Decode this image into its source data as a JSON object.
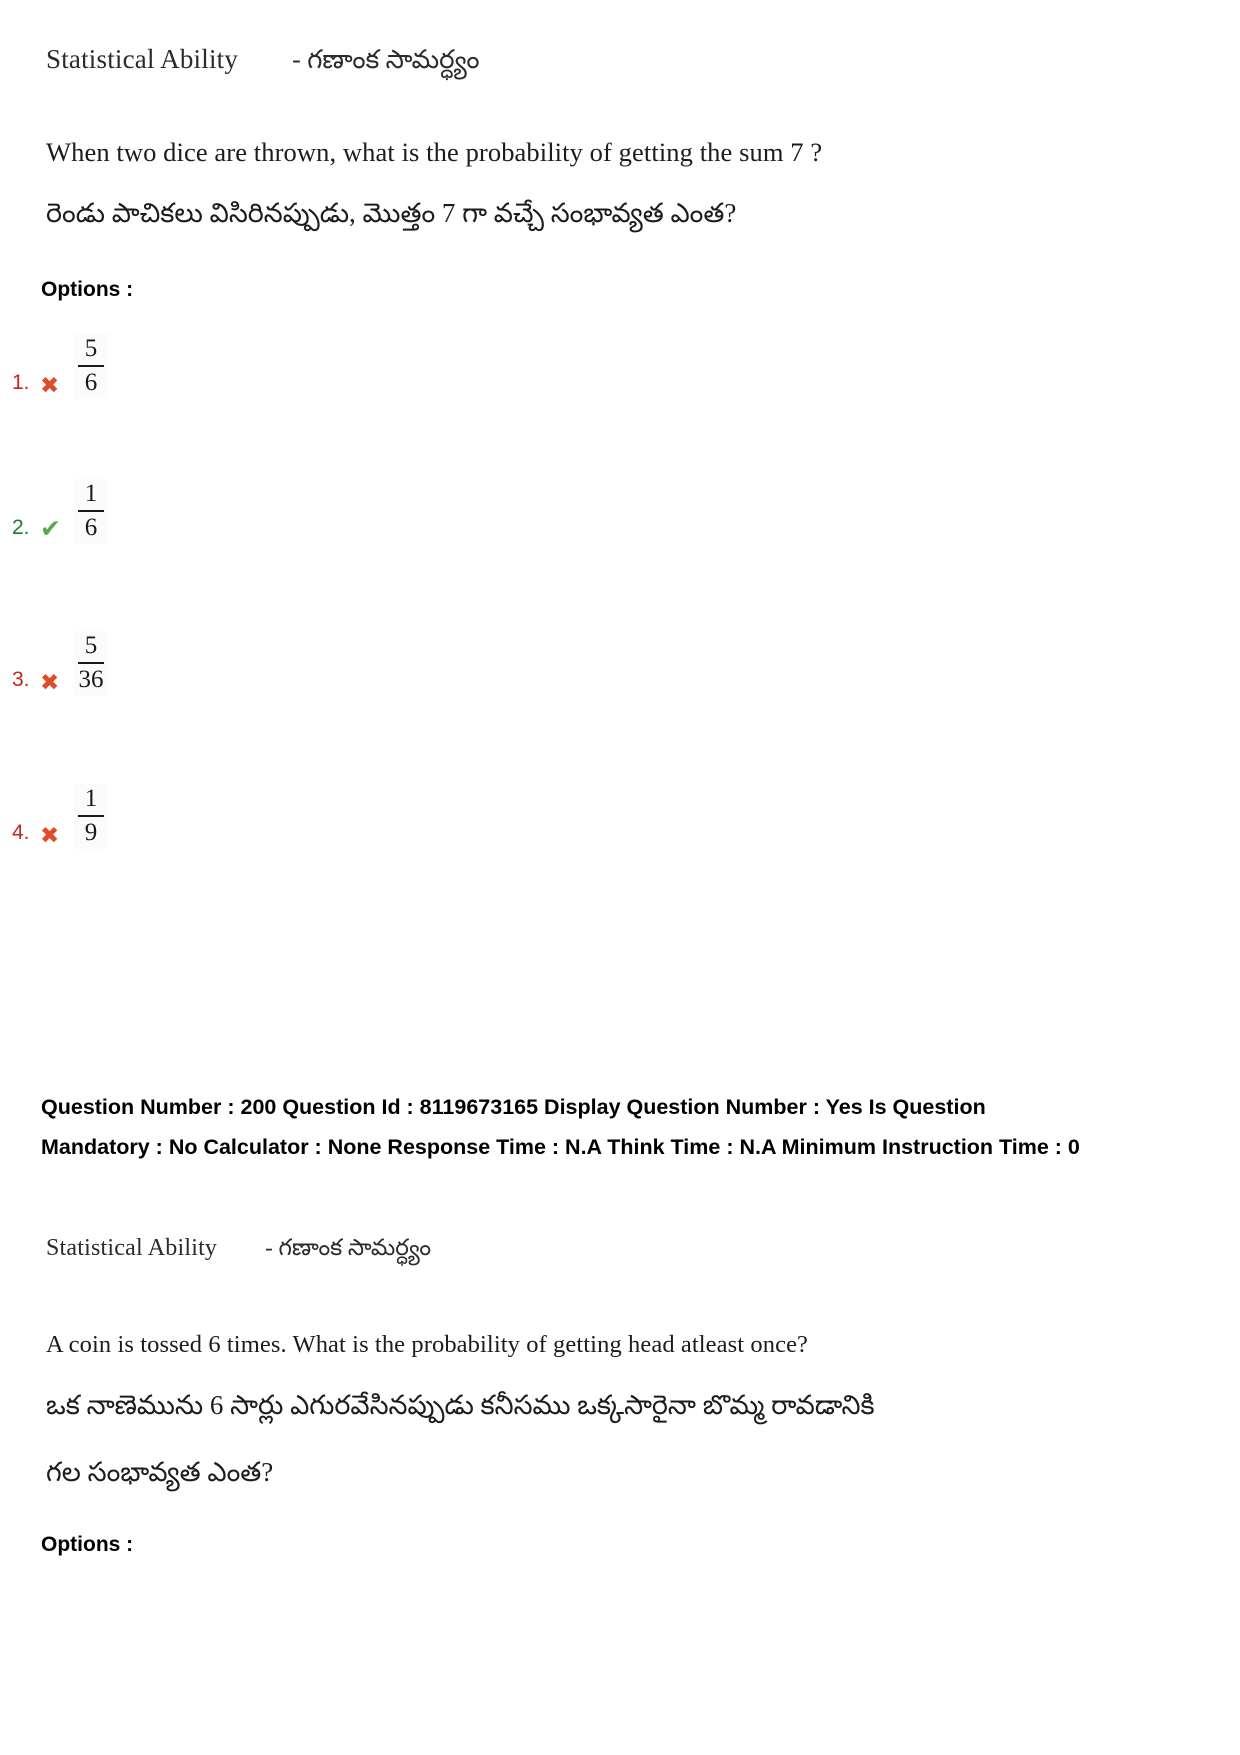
{
  "page": {
    "background_color": "#ffffff"
  },
  "colors": {
    "wrong_marker": "#e04b2a",
    "wrong_index": "#c2271b",
    "correct_marker": "#5aa84f",
    "correct_index": "#1f7a33",
    "text": "#1c1c1c"
  },
  "question1": {
    "subject_en": "Statistical Ability",
    "subject_te": "- గణాంక సామర్ధ్యం",
    "text_en": "When two dice are thrown, what is the probability of getting the sum 7 ?",
    "text_te": "రెండు పాచికలు విసిరినప్పుడు, మొత్తం 7 గా వచ్చే సంభావ్యత ఎంత?",
    "options_label": "Options :",
    "options": [
      {
        "index": "1.",
        "marker": "cross-icon",
        "marker_glyph": "✖",
        "numerator": "5",
        "denominator": "6",
        "correct": false
      },
      {
        "index": "2.",
        "marker": "check-icon",
        "marker_glyph": "✔",
        "numerator": "1",
        "denominator": "6",
        "correct": true
      },
      {
        "index": "3.",
        "marker": "cross-icon",
        "marker_glyph": "✖",
        "numerator": "5",
        "denominator": "36",
        "correct": false
      },
      {
        "index": "4.",
        "marker": "cross-icon",
        "marker_glyph": "✖",
        "numerator": "1",
        "denominator": "9",
        "correct": false
      }
    ]
  },
  "meta": {
    "text": "Question Number : 200 Question Id : 8119673165 Display Question Number : Yes Is Question Mandatory : No Calculator : None Response Time : N.A Think Time : N.A Minimum Instruction Time : 0",
    "fields": {
      "question_number_label": "Question Number :",
      "question_number": "200",
      "question_id_label": "Question Id :",
      "question_id": "8119673165",
      "display_question_number_label": "Display Question Number :",
      "display_question_number": "Yes",
      "is_question_mandatory_label": "Is Question Mandatory :",
      "is_question_mandatory": "No",
      "calculator_label": "Calculator :",
      "calculator": "None",
      "response_time_label": "Response Time :",
      "response_time": "N.A",
      "think_time_label": "Think Time :",
      "think_time": "N.A",
      "minimum_instruction_time_label": "Minimum Instruction Time :",
      "minimum_instruction_time": "0"
    }
  },
  "question2": {
    "subject_en": "Statistical Ability",
    "subject_te": "- గణాంక సామర్ధ్యం",
    "text_en": "A coin is tossed 6 times. What is the probability of getting head atleast once?",
    "text_te_line1": "ఒక నాణెమును 6 సార్లు ఎగురవేసినప్పుడు కనీసము ఒక్కసారైనా బొమ్మ రావడానికి",
    "text_te_line2": "గల సంభావ్యత ఎంత?",
    "options_label": "Options :"
  }
}
